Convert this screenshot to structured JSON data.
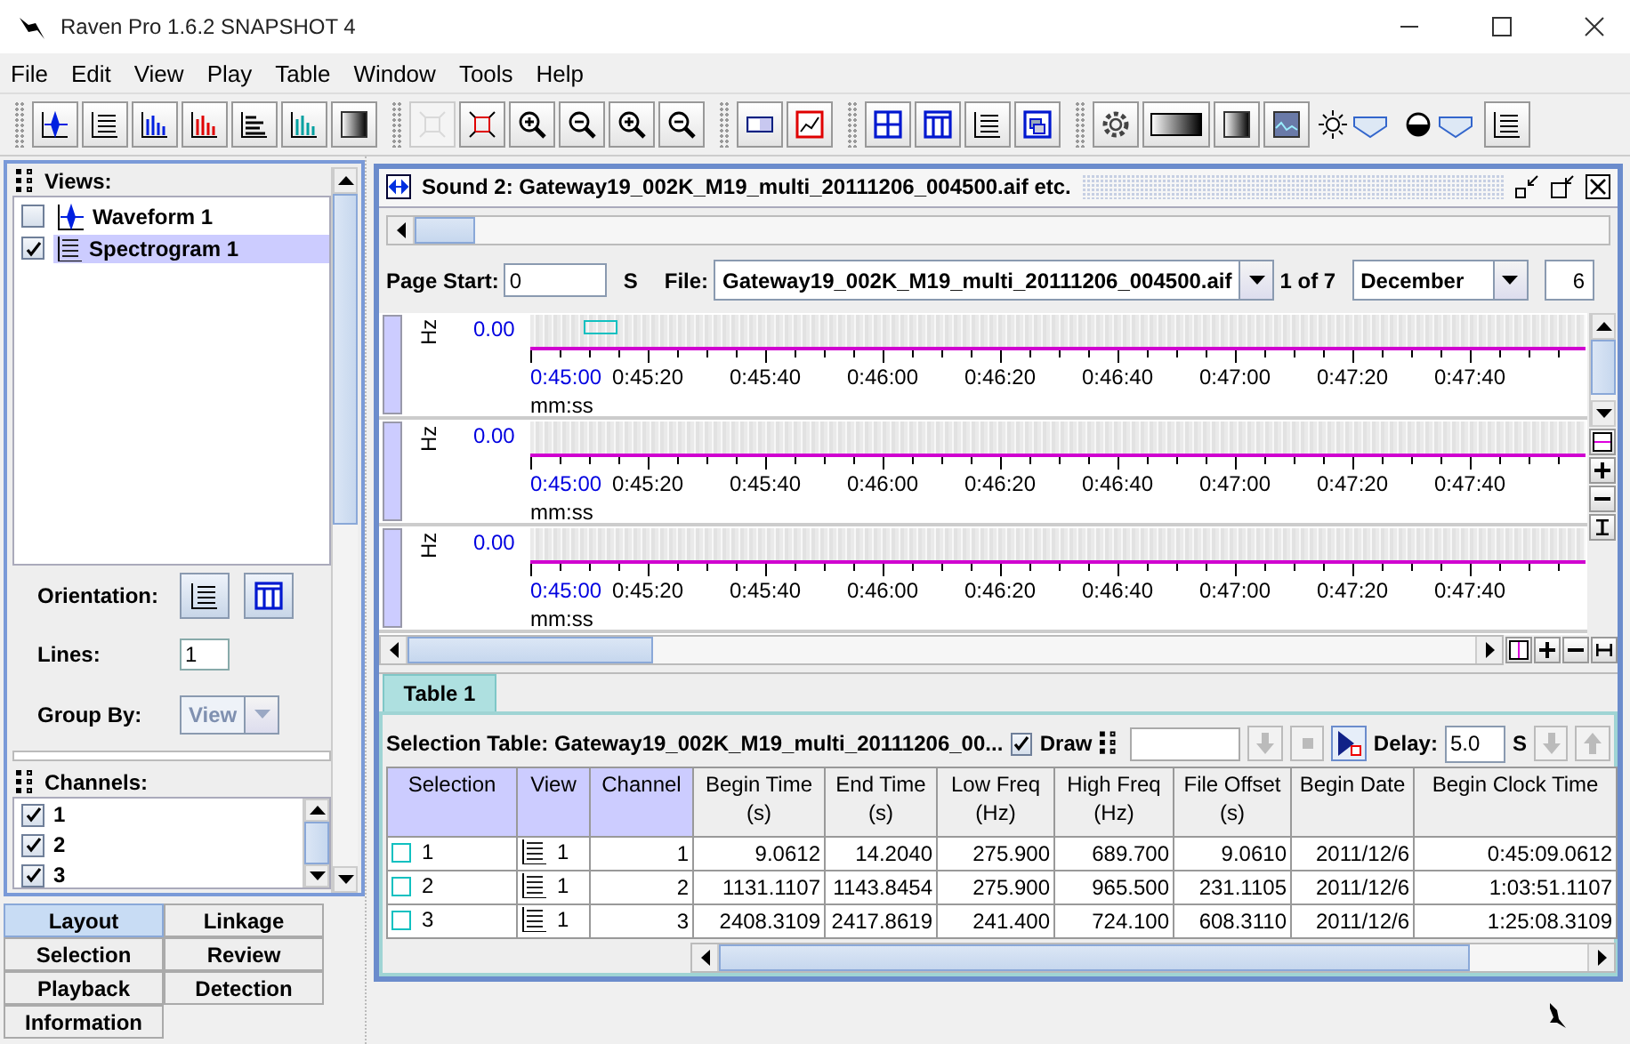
{
  "window": {
    "title": "Raven Pro 1.6.2 SNAPSHOT 4"
  },
  "menu": [
    "File",
    "Edit",
    "View",
    "Play",
    "Table",
    "Window",
    "Tools",
    "Help"
  ],
  "toolbar_groups": [
    {
      "buttons": [
        {
          "kind": "waveform",
          "disabled": false
        },
        {
          "kind": "spectrogram",
          "disabled": false
        },
        {
          "kind": "spectrum",
          "disabled": false
        },
        {
          "kind": "spectrum-red",
          "disabled": false
        },
        {
          "kind": "slice",
          "disabled": false
        },
        {
          "kind": "spectrum-teal",
          "disabled": false
        },
        {
          "kind": "gradient",
          "disabled": false
        }
      ]
    },
    {
      "buttons": [
        {
          "kind": "zoom-selection",
          "disabled": true
        },
        {
          "kind": "zoom-fit",
          "disabled": false
        },
        {
          "kind": "zoom-in",
          "disabled": false
        },
        {
          "kind": "zoom-out",
          "disabled": false
        },
        {
          "kind": "zoom-in",
          "disabled": false
        },
        {
          "kind": "zoom-out",
          "disabled": false
        }
      ]
    },
    {
      "buttons": [
        {
          "kind": "view",
          "disabled": false
        },
        {
          "kind": "chart",
          "disabled": false
        }
      ]
    },
    {
      "buttons": [
        {
          "kind": "grid",
          "disabled": false
        },
        {
          "kind": "columns",
          "disabled": false
        },
        {
          "kind": "rows",
          "disabled": false
        },
        {
          "kind": "windows",
          "disabled": false
        }
      ]
    },
    {
      "buttons": [
        {
          "kind": "gear",
          "disabled": false
        },
        {
          "kind": "colormap",
          "disabled": false
        },
        {
          "kind": "invert",
          "disabled": false
        },
        {
          "kind": "image",
          "disabled": false
        },
        {
          "kind": "brightness",
          "disabled": false
        },
        {
          "kind": "contrast",
          "disabled": false
        },
        {
          "kind": "rows",
          "disabled": false
        }
      ]
    }
  ],
  "layout_panel": {
    "views_header": "Views:",
    "views": [
      {
        "kind": "waveform",
        "label": "Waveform 1",
        "checked": false,
        "selected": false
      },
      {
        "kind": "spectrogram",
        "label": "Spectrogram 1",
        "checked": true,
        "selected": true
      }
    ],
    "orientation_label": "Orientation:",
    "lines_label": "Lines:",
    "lines_value": "1",
    "group_by_label": "Group By:",
    "group_by_value": "View",
    "group_by_disabled": true,
    "channels_header": "Channels:",
    "channels": [
      {
        "label": "1",
        "checked": true
      },
      {
        "label": "2",
        "checked": true
      },
      {
        "label": "3",
        "checked": true
      }
    ],
    "tab_rows": [
      {
        "tabs": [
          {
            "label": "Layout",
            "selected": true
          },
          {
            "label": "Linkage",
            "selected": false
          }
        ]
      },
      {
        "tabs": [
          {
            "label": "Selection",
            "selected": false
          },
          {
            "label": "Review",
            "selected": false
          }
        ]
      },
      {
        "tabs": [
          {
            "label": "Playback",
            "selected": false
          },
          {
            "label": "Detection",
            "selected": false
          }
        ]
      },
      {
        "tabs": [
          {
            "label": "Information",
            "selected": false
          }
        ]
      }
    ]
  },
  "sound_window": {
    "title": "Sound 2: Gateway19_002K_M19_multi_20111206_004500.aif etc.",
    "page_start_label": "Page Start:",
    "page_start_value": "0",
    "page_start_unit": "S",
    "file_label": "File:",
    "file_value": "Gateway19_002K_M19_multi_20111206_004500.aif",
    "file_count": "1 of 7",
    "month": "December",
    "day": "6",
    "plots": [
      {
        "axis_label": "Hz",
        "value": "0.00",
        "unit": "mm:ss",
        "has_selection": true,
        "ticks": [
          "0:45:00",
          "0:45:20",
          "0:45:40",
          "0:46:00",
          "0:46:20",
          "0:46:40",
          "0:47:00",
          "0:47:20",
          "0:47:40"
        ]
      },
      {
        "axis_label": "Hz",
        "value": "0.00",
        "unit": "mm:ss",
        "has_selection": false,
        "ticks": [
          "0:45:00",
          "0:45:20",
          "0:45:40",
          "0:46:00",
          "0:46:20",
          "0:46:40",
          "0:47:00",
          "0:47:20",
          "0:47:40"
        ]
      },
      {
        "axis_label": "Hz",
        "value": "0.00",
        "unit": "mm:ss",
        "has_selection": false,
        "ticks": [
          "0:45:00",
          "0:45:20",
          "0:45:40",
          "0:46:00",
          "0:46:20",
          "0:46:40",
          "0:47:00",
          "0:47:20",
          "0:47:40"
        ]
      }
    ]
  },
  "table_panel": {
    "tab": "Table 1",
    "title": "Selection Table: Gateway19_002K_M19_multi_20111206_00...",
    "draw_label": "Draw",
    "draw_checked": true,
    "delay_label": "Delay:",
    "delay_value": "5.0",
    "delay_unit": "S",
    "columns": [
      {
        "label": "Selection",
        "key": true
      },
      {
        "label": "View",
        "key": true
      },
      {
        "label": "Channel",
        "key": true
      },
      {
        "label": "Begin Time\n(s)",
        "key": false
      },
      {
        "label": "End Time\n(s)",
        "key": false
      },
      {
        "label": "Low Freq\n(Hz)",
        "key": false
      },
      {
        "label": "High Freq\n(Hz)",
        "key": false
      },
      {
        "label": "File Offset\n(s)",
        "key": false
      },
      {
        "label": "Begin Date",
        "key": false
      },
      {
        "label": "Begin Clock Time",
        "key": false
      }
    ],
    "rows": [
      {
        "cells": [
          "1",
          "1",
          "1",
          "9.0612",
          "14.2040",
          "275.900",
          "689.700",
          "9.0610",
          "2011/12/6",
          "0:45:09.0612"
        ]
      },
      {
        "cells": [
          "2",
          "1",
          "2",
          "1131.1107",
          "1143.8454",
          "275.900",
          "965.500",
          "231.1105",
          "2011/12/6",
          "1:03:51.1107"
        ]
      },
      {
        "cells": [
          "3",
          "1",
          "3",
          "2408.3109",
          "2417.8619",
          "241.400",
          "724.100",
          "608.3110",
          "2011/12/6",
          "1:25:08.3109"
        ]
      }
    ]
  }
}
